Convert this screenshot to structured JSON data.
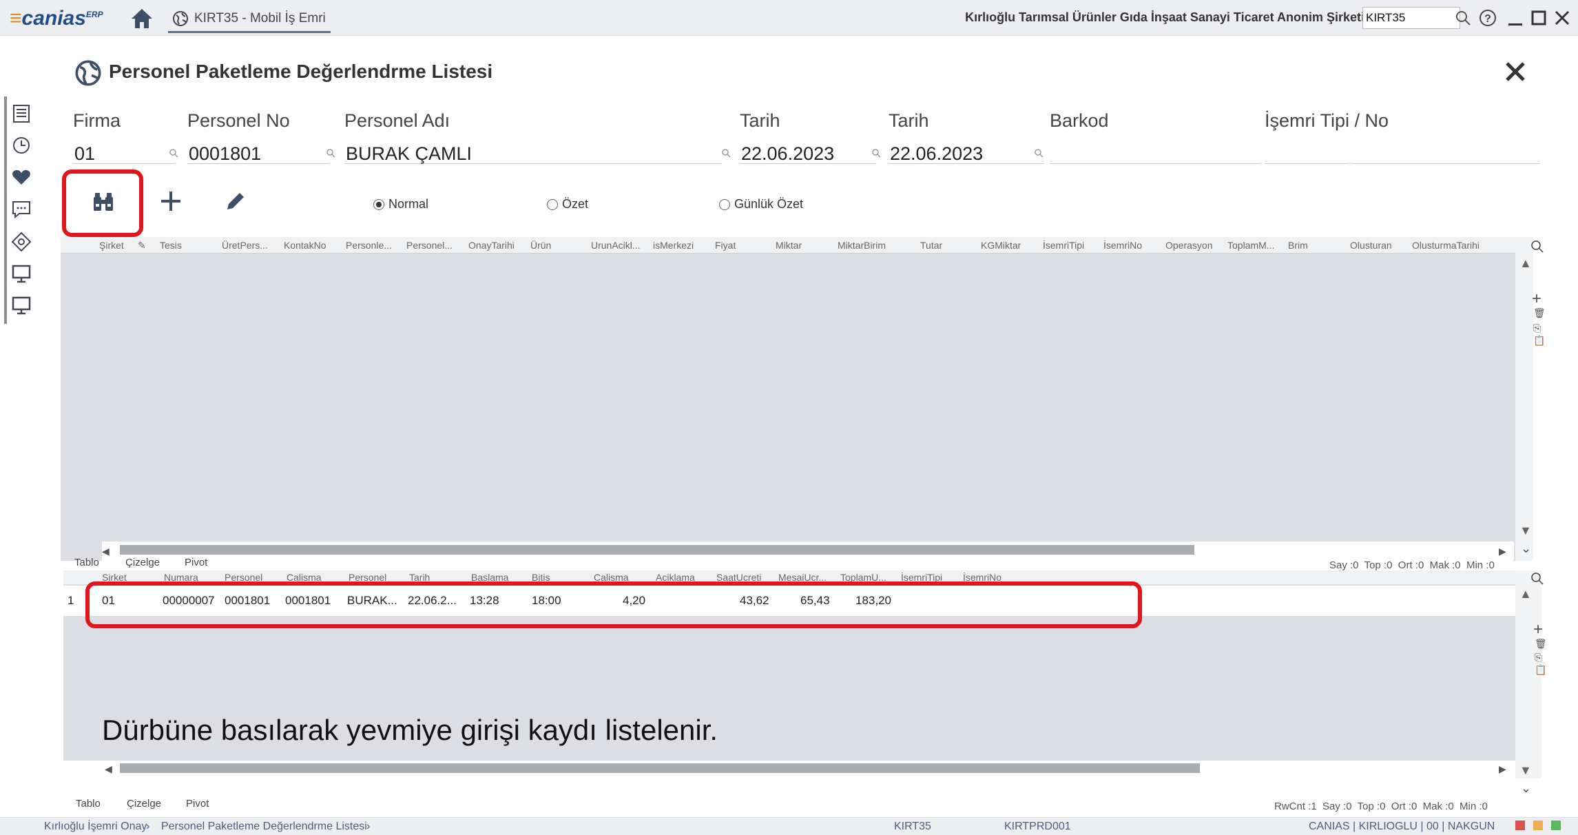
{
  "app": {
    "logo": "canias",
    "logo_sup": "ERP",
    "tab_title": "KIRT35 - Mobil İş Emri",
    "company": "Kırlıoğlu Tarımsal Ürünler Gıda İnşaat Sanayi Ticaret Anonim Şirketi",
    "company_code": "KIRT35"
  },
  "form": {
    "title": "Personel Paketleme Değerlendrme Listesi",
    "fields": [
      {
        "label": "Firma",
        "value": "01"
      },
      {
        "label": "Personel No",
        "value": "0001801"
      },
      {
        "label": "Personel Adı",
        "value": "BURAK ÇAMLI"
      },
      {
        "label": "Tarih",
        "value": "22.06.2023"
      },
      {
        "label": "Tarih",
        "value": "22.06.2023"
      },
      {
        "label": "Barkod",
        "value": ""
      },
      {
        "label": "İşemri Tipi / No",
        "value": ""
      }
    ],
    "radios": [
      {
        "label": "Normal",
        "selected": true
      },
      {
        "label": "Özet",
        "selected": false
      },
      {
        "label": "Günlük Özet",
        "selected": false
      }
    ]
  },
  "grid1": {
    "columns": [
      "Şirket",
      "Tesis",
      "ÜretPers...",
      "KontakNo",
      "Personle...",
      "Personel...",
      "OnayTarihi",
      "Ürün",
      "UrunAcikl...",
      "isMerkezi",
      "Fiyat",
      "Miktar",
      "MiktarBirim",
      "Tutar",
      "KGMiktar",
      "İsemriTipi",
      "İsemriNo",
      "Operasyon",
      "ToplamM...",
      "Brim",
      "Olusturan",
      "OlusturmaTarihi"
    ],
    "tabs": [
      "Tablo",
      "Çizelge",
      "Pivot"
    ],
    "stats": "Say :0  Top :0  Ort :0  Mak :0  Min :0"
  },
  "grid2": {
    "columns": [
      "Sirket",
      "Numara",
      "Personel",
      "Calisma",
      "Personel",
      "Tarih",
      "Baslama",
      "Bitis",
      "Calisma",
      "Aciklama",
      "SaatUcreti",
      "MesaiUcr...",
      "ToplamU...",
      "İsemriTipi",
      "İsemriNo"
    ],
    "rows": [
      [
        "1",
        "01",
        "00000007",
        "0001801",
        "0001801",
        "BURAK...",
        "22.06.2...",
        "13:28",
        "18:00",
        "4,20",
        "",
        "43,62",
        "65,43",
        "183,20",
        "",
        ""
      ]
    ],
    "tabs": [
      "Tablo",
      "Çizelge",
      "Pivot"
    ],
    "stats": "RwCnt :1  Say :0  Top :0  Ort :0  Mak :0  Min :0"
  },
  "caption": "Dürbüne basılarak yevmiye girişi kaydı listelenir.",
  "status": {
    "breadcrumb1": "Kırlıoğlu İşemri Onay",
    "breadcrumb2": "Personel Paketleme Değerlendrme Listesi",
    "company": "KIRT35",
    "server": "KIRTPRD001",
    "session": "CANIAS | KIRLIOGLU | 00 | NAKGUN"
  },
  "colors": {
    "highlight": "#e0161a",
    "brand": "#1f4f8a"
  }
}
